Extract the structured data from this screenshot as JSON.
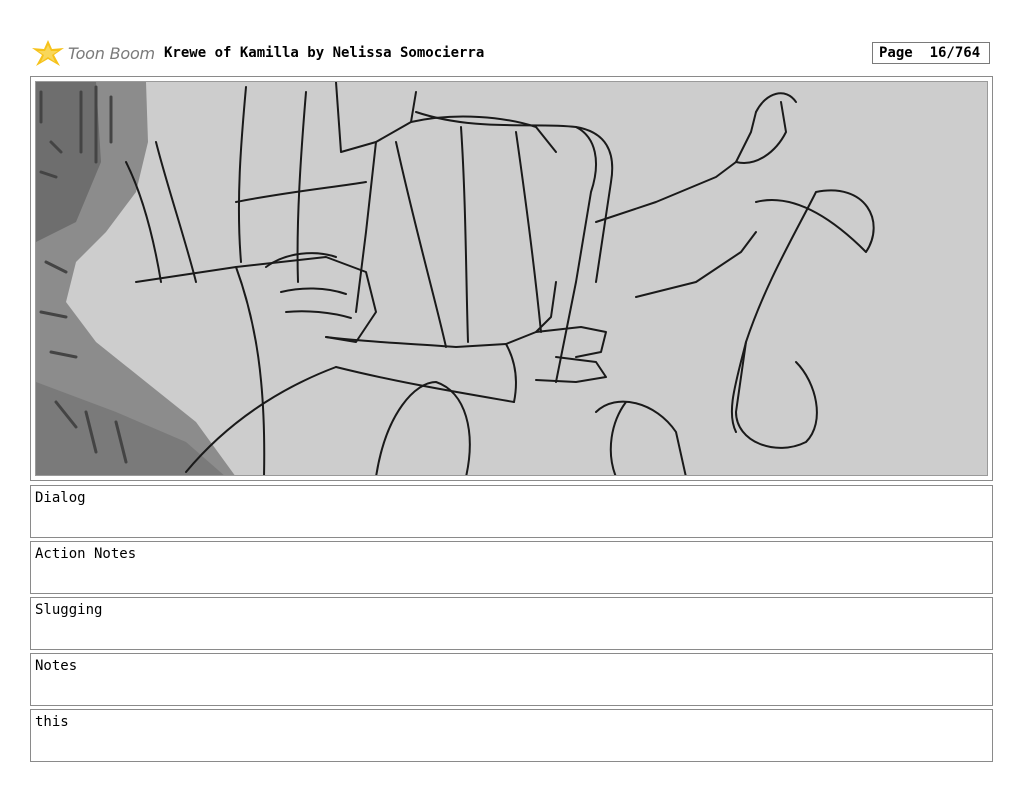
{
  "header": {
    "logo_text": "Toon Boom",
    "title": "Krewe of Kamilla by Nelissa Somocierra",
    "page_label": "Page",
    "page_number": "16/764"
  },
  "panel": {
    "image_icon": "storyboard-sketch"
  },
  "fields": {
    "dialog": "Dialog",
    "action_notes": "Action Notes",
    "slugging": "Slugging",
    "notes": "Notes",
    "extra": "this"
  }
}
